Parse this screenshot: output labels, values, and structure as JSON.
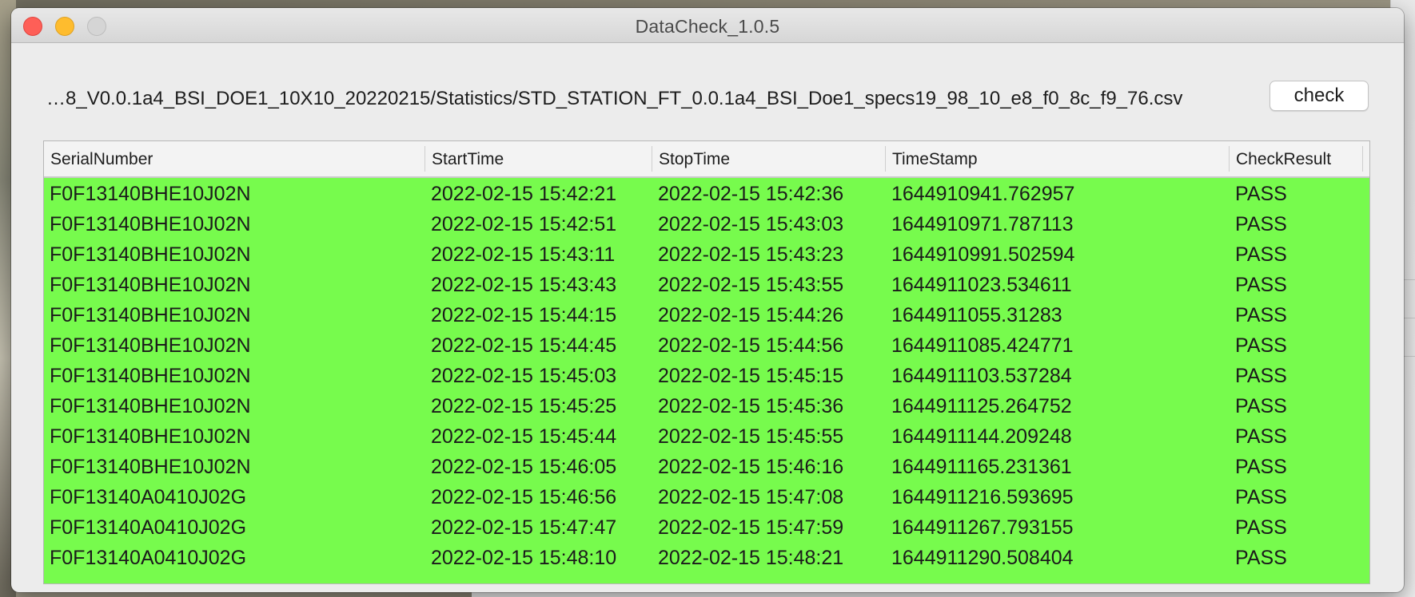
{
  "window": {
    "title": "DataCheck_1.0.5"
  },
  "path": {
    "text": "…8_V0.0.1a4_BSI_DOE1_10X10_20220215/Statistics/STD_STATION_FT_0.0.1a4_BSI_Doe1_specs19_98_10_e8_f0_8c_f9_76.csv"
  },
  "toolbar": {
    "check_label": "check"
  },
  "table": {
    "columns": [
      "SerialNumber",
      "StartTime",
      "StopTime",
      "TimeStamp",
      "CheckResult"
    ],
    "row_color": "#77fb4d",
    "rows": [
      [
        "F0F13140BHE10J02N",
        "2022-02-15 15:42:21",
        "2022-02-15 15:42:36",
        "1644910941.762957",
        "PASS"
      ],
      [
        "F0F13140BHE10J02N",
        "2022-02-15 15:42:51",
        "2022-02-15 15:43:03",
        "1644910971.787113",
        "PASS"
      ],
      [
        "F0F13140BHE10J02N",
        "2022-02-15 15:43:11",
        "2022-02-15 15:43:23",
        "1644910991.502594",
        "PASS"
      ],
      [
        "F0F13140BHE10J02N",
        "2022-02-15 15:43:43",
        "2022-02-15 15:43:55",
        "1644911023.534611",
        "PASS"
      ],
      [
        "F0F13140BHE10J02N",
        "2022-02-15 15:44:15",
        "2022-02-15 15:44:26",
        "1644911055.31283",
        "PASS"
      ],
      [
        "F0F13140BHE10J02N",
        "2022-02-15 15:44:45",
        "2022-02-15 15:44:56",
        "1644911085.424771",
        "PASS"
      ],
      [
        "F0F13140BHE10J02N",
        "2022-02-15 15:45:03",
        "2022-02-15 15:45:15",
        "1644911103.537284",
        "PASS"
      ],
      [
        "F0F13140BHE10J02N",
        "2022-02-15 15:45:25",
        "2022-02-15 15:45:36",
        "1644911125.264752",
        "PASS"
      ],
      [
        "F0F13140BHE10J02N",
        "2022-02-15 15:45:44",
        "2022-02-15 15:45:55",
        "1644911144.209248",
        "PASS"
      ],
      [
        "F0F13140BHE10J02N",
        "2022-02-15 15:46:05",
        "2022-02-15 15:46:16",
        "1644911165.231361",
        "PASS"
      ],
      [
        "F0F13140A0410J02G",
        "2022-02-15 15:46:56",
        "2022-02-15 15:47:08",
        "1644911216.593695",
        "PASS"
      ],
      [
        "F0F13140A0410J02G",
        "2022-02-15 15:47:47",
        "2022-02-15 15:47:59",
        "1644911267.793155",
        "PASS"
      ],
      [
        "F0F13140A0410J02G",
        "2022-02-15 15:48:10",
        "2022-02-15 15:48:21",
        "1644911290.508404",
        "PASS"
      ]
    ]
  }
}
